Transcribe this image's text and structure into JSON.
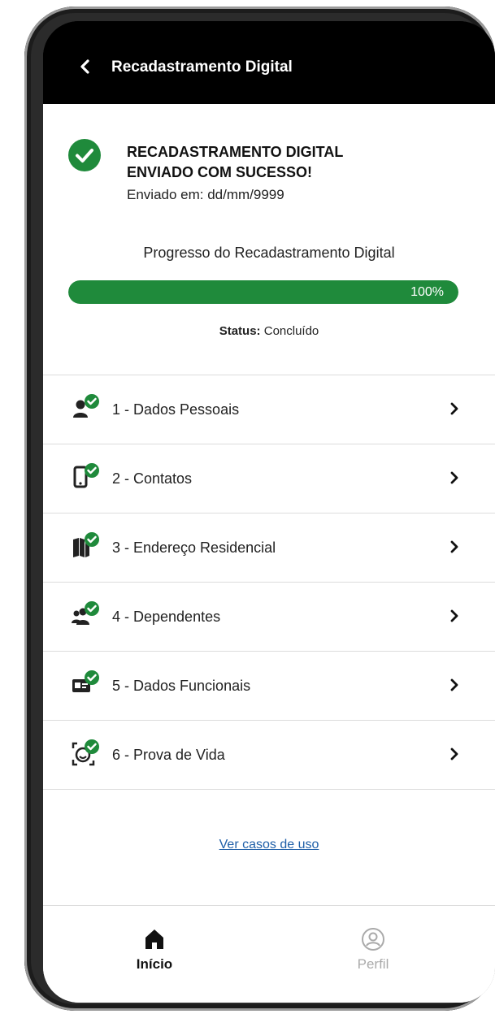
{
  "header": {
    "title": "Recadastramento Digital",
    "back_icon": "chevron-left-icon"
  },
  "success": {
    "icon": "check-circle-icon",
    "title_line1": "RECADASTRAMENTO DIGITAL",
    "title_line2": "ENVIADO COM SUCESSO!",
    "sent_date": "Enviado em: dd/mm/9999"
  },
  "progress": {
    "label": "Progresso do Recadastramento Digital",
    "percent": 100,
    "percent_text": "100%",
    "status_label": "Status:",
    "status_value": "Concluído"
  },
  "steps": [
    {
      "label": "1 - Dados Pessoais",
      "icon": "person-check-icon"
    },
    {
      "label": "2 - Contatos",
      "icon": "phone-check-icon"
    },
    {
      "label": "3 - Endereço Residencial",
      "icon": "map-check-icon"
    },
    {
      "label": "4 - Dependentes",
      "icon": "people-check-icon"
    },
    {
      "label": "5 - Dados Funcionais",
      "icon": "badge-check-icon"
    },
    {
      "label": "6 - Prova de Vida",
      "icon": "face-scan-check-icon"
    }
  ],
  "link": {
    "use_cases": "Ver casos de uso"
  },
  "bottom_nav": {
    "home_label": "Início",
    "profile_label": "Perfil"
  },
  "colors": {
    "accent_green": "#1f8a3b",
    "header_bg": "#000000",
    "link_blue": "#1f5fa8"
  }
}
